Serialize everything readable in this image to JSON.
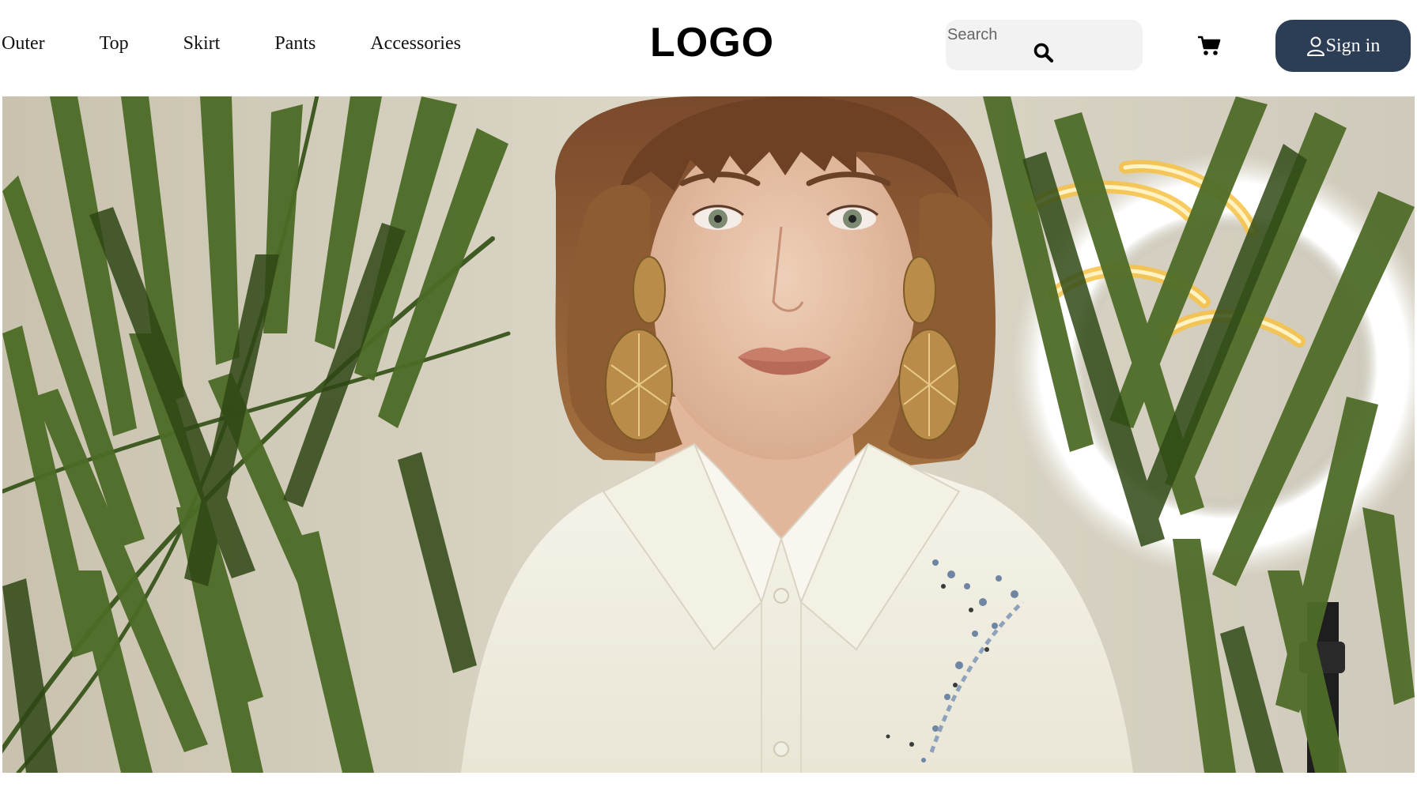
{
  "nav": {
    "items": [
      {
        "label": "Outer"
      },
      {
        "label": "Top"
      },
      {
        "label": "Skirt"
      },
      {
        "label": "Pants"
      },
      {
        "label": "Accessories"
      }
    ]
  },
  "logo": {
    "text": "LOGO"
  },
  "search": {
    "placeholder": "Search",
    "icon": "search-icon"
  },
  "cart": {
    "icon": "cart-icon"
  },
  "signin": {
    "label": "Sign in",
    "icon": "user-icon"
  },
  "hero": {
    "image": "model-with-palm-leaves"
  },
  "colors": {
    "signin_bg": "#2c3e55",
    "search_bg": "#f2f2f2",
    "text": "#111111"
  }
}
